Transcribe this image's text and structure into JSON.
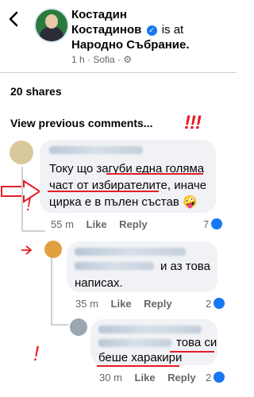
{
  "header": {
    "back_icon": "chevron-left-icon",
    "author": "Костадин Костадинов",
    "author_line1": "Костадин",
    "author_line2": "Костадинов",
    "verb": "is at",
    "place": "Народно Събрание.",
    "meta": "1 h · Sofia · ⚙"
  },
  "post": {
    "shares": "20 shares",
    "view_previous": "View previous comments...",
    "annotation_marks": "!!!"
  },
  "comments": [
    {
      "text_line1": "Току що загуби една голяма",
      "text_line2": "част от избирателите, иначе",
      "text_line3": "цирка е в пълен състав 🤪",
      "time": "55 m",
      "like": "Like",
      "reply": "Reply",
      "reactions": "7"
    },
    {
      "text_line1": "и аз това",
      "text_line2": "написах.",
      "time": "35 m",
      "like": "Like",
      "reply": "Reply",
      "reactions": "2"
    },
    {
      "text_line1": "това си",
      "text_line2": "беше харакири",
      "time": "30 m",
      "like": "Like",
      "reply": "Reply",
      "reactions": "2"
    }
  ],
  "colors": {
    "accent": "#1877f2",
    "annotation_red": "#e41e26",
    "bubble": "#f0f2f5",
    "muted": "#65676b"
  }
}
